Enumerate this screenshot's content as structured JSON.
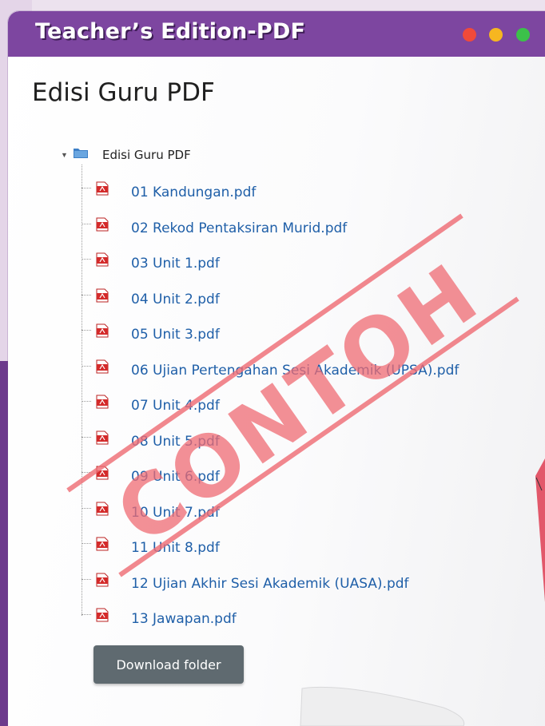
{
  "window": {
    "title": "Teacher’s Edition-PDF",
    "controls": [
      "close-dot",
      "minimize-dot",
      "maximize-dot"
    ]
  },
  "page": {
    "heading": "Edisi Guru PDF"
  },
  "tree": {
    "root_label": "Edisi Guru PDF",
    "files": [
      "01 Kandungan.pdf",
      "02 Rekod Pentaksiran Murid.pdf",
      "03 Unit 1.pdf",
      "04 Unit 2.pdf",
      "05 Unit 3.pdf",
      "06 Ujian Pertengahan Sesi Akademik (UPSA).pdf",
      "07 Unit 4.pdf",
      "08 Unit 5.pdf",
      "09 Unit 6.pdf",
      "10 Unit 7.pdf",
      "11 Unit 8.pdf",
      "12 Ujian Akhir Sesi Akademik (UASA).pdf",
      "13 Jawapan.pdf"
    ]
  },
  "actions": {
    "download_label": "Download folder"
  },
  "watermark": {
    "text": "CONTOH"
  },
  "colors": {
    "title_bar": "#7d46a0",
    "link": "#1f5fa8",
    "button": "#5f6a70",
    "watermark": "#ef6b73"
  }
}
